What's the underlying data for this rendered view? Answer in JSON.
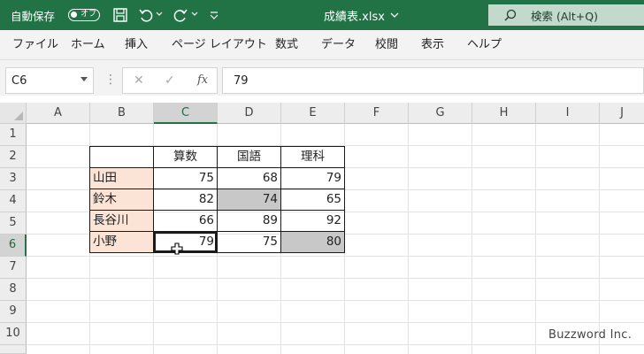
{
  "titlebar": {
    "autosave_label": "自動保存",
    "toggle_text": "オフ",
    "file_title": "成績表.xlsx",
    "search_placeholder": "検索 (Alt+Q)"
  },
  "menu": [
    "ファイル",
    "ホーム",
    "挿入",
    "ページ レイアウト",
    "数式",
    "データ",
    "校閲",
    "表示",
    "ヘルプ"
  ],
  "formula_bar": {
    "name_box": "C6",
    "fx_label": "fx",
    "value": "79"
  },
  "columns": [
    "A",
    "B",
    "C",
    "D",
    "E",
    "F",
    "G",
    "H",
    "I",
    "J"
  ],
  "rows": [
    "1",
    "2",
    "3",
    "4",
    "5",
    "6",
    "7",
    "8",
    "9",
    "10"
  ],
  "selected_cell": {
    "column": "C",
    "row": "6"
  },
  "table": {
    "headers": [
      "算数",
      "国語",
      "理科"
    ],
    "records": [
      {
        "name": "山田",
        "values": [
          "75",
          "68",
          "79"
        ]
      },
      {
        "name": "鈴木",
        "values": [
          "82",
          "74",
          "65"
        ]
      },
      {
        "name": "長谷川",
        "values": [
          "66",
          "89",
          "92"
        ]
      },
      {
        "name": "小野",
        "values": [
          "79",
          "75",
          "80"
        ]
      }
    ],
    "highlighted_cells": [
      "D4",
      "E6"
    ]
  },
  "colors": {
    "excel_green": "#217346",
    "name_fill": "#fbe3d6",
    "highlight_fill": "#c8c8c8"
  },
  "watermark": "Buzzword Inc."
}
